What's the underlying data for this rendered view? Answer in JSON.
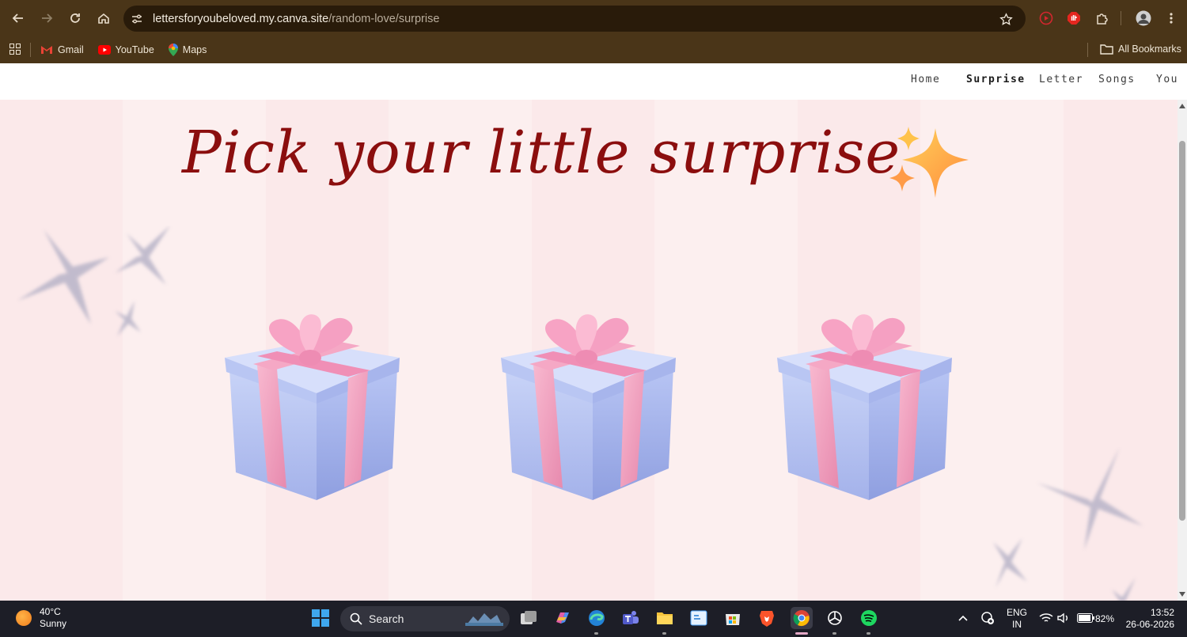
{
  "browser": {
    "url_host": "lettersforyoubeloved.my.canva.site",
    "url_path": "/random-love/surprise",
    "bookmarks": [
      "Gmail",
      "YouTube",
      "Maps"
    ],
    "all_bookmarks_label": "All Bookmarks"
  },
  "site_nav": {
    "items": [
      "Home",
      "Surprise",
      "Letter",
      "Songs",
      "You"
    ],
    "active": "Surprise"
  },
  "page": {
    "headline": "Pick your little surprise",
    "sparkle_emoji": "sparkles-icon",
    "gifts": [
      "gift-box-icon",
      "gift-box-icon",
      "gift-box-icon"
    ],
    "colors": {
      "headline": "#8b0e0e",
      "background": "#fbeeee",
      "gift_box": "#b6c3f2",
      "ribbon": "#f3a6c4"
    }
  },
  "taskbar": {
    "weather_temp": "40°C",
    "weather_desc": "Sunny",
    "search_label": "Search",
    "lang_top": "ENG",
    "lang_bottom": "IN",
    "battery": "82%",
    "time": "13:52",
    "date": "26-06-2026"
  }
}
